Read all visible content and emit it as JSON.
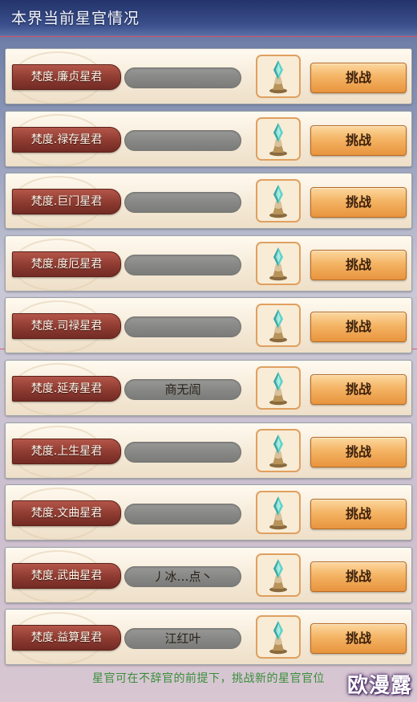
{
  "header": {
    "title": "本界当前星官情况"
  },
  "rows": [
    {
      "title": "梵度.廉贞星君",
      "holder": "",
      "button": "挑战"
    },
    {
      "title": "梵度.禄存星君",
      "holder": "",
      "button": "挑战"
    },
    {
      "title": "梵度.巨门星君",
      "holder": "",
      "button": "挑战"
    },
    {
      "title": "梵度.度厄星君",
      "holder": "",
      "button": "挑战"
    },
    {
      "title": "梵度.司禄星君",
      "holder": "",
      "button": "挑战"
    },
    {
      "title": "梵度.延寿星君",
      "holder": "商无訚",
      "button": "挑战"
    },
    {
      "title": "梵度.上生星君",
      "holder": "",
      "button": "挑战"
    },
    {
      "title": "梵度.文曲星君",
      "holder": "",
      "button": "挑战"
    },
    {
      "title": "梵度.武曲星君",
      "holder": "丿冰…点丶",
      "button": "挑战"
    },
    {
      "title": "梵度.益算星君",
      "holder": "江红叶",
      "button": "挑战"
    }
  ],
  "footer": {
    "tip": "星官可在不辞官的前提下，挑战新的星官官位"
  },
  "watermark": "欧漫露",
  "colors": {
    "banner": "#8d3a30",
    "button": "#f4b464",
    "footer_text": "#3a8e3a",
    "header_bg": "#2a3a72"
  },
  "icons": {
    "row_icon": "crystal-statue-icon"
  }
}
